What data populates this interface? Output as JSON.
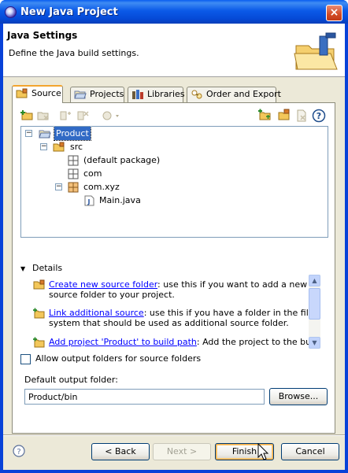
{
  "window": {
    "title": "New Java Project",
    "close_glyph": "×"
  },
  "header": {
    "title": "Java Settings",
    "description": "Define the Java build settings."
  },
  "tabs": [
    {
      "label": "Source",
      "icon": "source-folder-icon",
      "active": true
    },
    {
      "label": "Projects",
      "icon": "projects-icon",
      "active": false
    },
    {
      "label": "Libraries",
      "icon": "libraries-icon",
      "active": false
    },
    {
      "label": "Order and Export",
      "icon": "order-export-icon",
      "active": false
    }
  ],
  "toolbar": {
    "left_icons": [
      "add-source-folder-icon",
      "remove-icon",
      "include-icon",
      "exclude-icon",
      "configure-dropdown-icon"
    ],
    "right_icons": [
      "link-source-icon",
      "new-folder-icon",
      "delete-icon",
      "help-icon"
    ]
  },
  "tree": {
    "nodes": [
      {
        "label": "Product",
        "icon": "project-icon",
        "expander": "−",
        "selected": true
      },
      {
        "label": "src",
        "icon": "source-folder-icon",
        "expander": "−"
      },
      {
        "label": "(default package)",
        "icon": "package-icon"
      },
      {
        "label": "com",
        "icon": "package-icon"
      },
      {
        "label": "com.xyz",
        "icon": "package-icon",
        "expander": "−"
      },
      {
        "label": "Main.java",
        "icon": "java-file-icon"
      }
    ]
  },
  "details": {
    "heading": "Details",
    "items": [
      {
        "link": "Create new source folder",
        "text": ": use this if you want to add a new source folder to your project."
      },
      {
        "link": "Link additional source",
        "text": ": use this if you have a folder in the file system that should be used as additional source folder."
      },
      {
        "link": "Add project 'Product' to build path",
        "text": ": Add the project to the build path if"
      }
    ]
  },
  "options": {
    "allow_output_label": "Allow output folders for source folders",
    "allow_output_checked": false
  },
  "output": {
    "label": "Default output folder:",
    "value": "Product/bin",
    "browse_label": "Browse..."
  },
  "buttons": {
    "back": "< Back",
    "next": "Next >",
    "finish": "Finish",
    "cancel": "Cancel"
  },
  "colors": {
    "titlebar": "#0a5ae8",
    "selection": "#316ac5",
    "link": "#0000ff"
  }
}
